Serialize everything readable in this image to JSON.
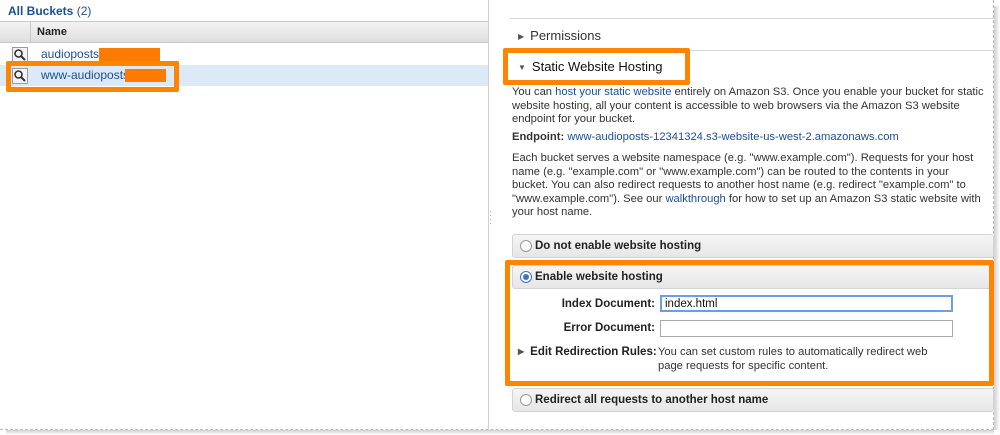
{
  "left_panel": {
    "title": "All Buckets",
    "count": "(2)",
    "column_header": "Name",
    "buckets": [
      {
        "name": "audioposts-1",
        "selected": false
      },
      {
        "name": "www-audioposts-1",
        "selected": true
      }
    ]
  },
  "right_panel": {
    "permissions_label": "Permissions",
    "section_title": "Static Website Hosting",
    "intro_prefix": "You can ",
    "intro_link": "host your static website",
    "intro_line1_rest": " entirely on Amazon S3. Once you enable your bucket for static",
    "intro_line2": "website hosting, all your content is accessible to web browsers via the Amazon S3 website",
    "intro_line3": "endpoint for your bucket.",
    "endpoint_label": "Endpoint:",
    "endpoint_value": "www-audioposts-12341324.s3-website-us-west-2.amazonaws.com",
    "ns_line1": "Each bucket serves a website namespace (e.g. \"www.example.com\"). Requests for your host",
    "ns_line2": "name (e.g. \"example.com\" or \"www.example.com\") can be routed to the contents in your",
    "ns_line3": "bucket. You can also redirect requests to another host name (e.g. redirect \"example.com\" to",
    "ns_line4_prefix": "\"www.example.com\"). See our ",
    "ns_link": "walkthrough",
    "ns_line4_rest": " for how to set up an Amazon S3 static website with",
    "ns_line5": "your host name.",
    "option_disable": "Do not enable website hosting",
    "option_enable": "Enable website hosting",
    "index_label": "Index Document:",
    "index_value": "index.html",
    "error_label": "Error Document:",
    "error_value": "",
    "redirection_label": "Edit Redirection Rules:",
    "redirection_desc_line1": "You can set custom rules to automatically redirect web",
    "redirection_desc_line2": "page requests for specific content.",
    "option_redirect": "Redirect all requests to another host name",
    "selected_option": "Enable website hosting"
  },
  "colors": {
    "highlight": "#ff8400",
    "link": "#1a4f9b",
    "selected_row": "#dce9f7",
    "redaction": "#ff7a00"
  }
}
